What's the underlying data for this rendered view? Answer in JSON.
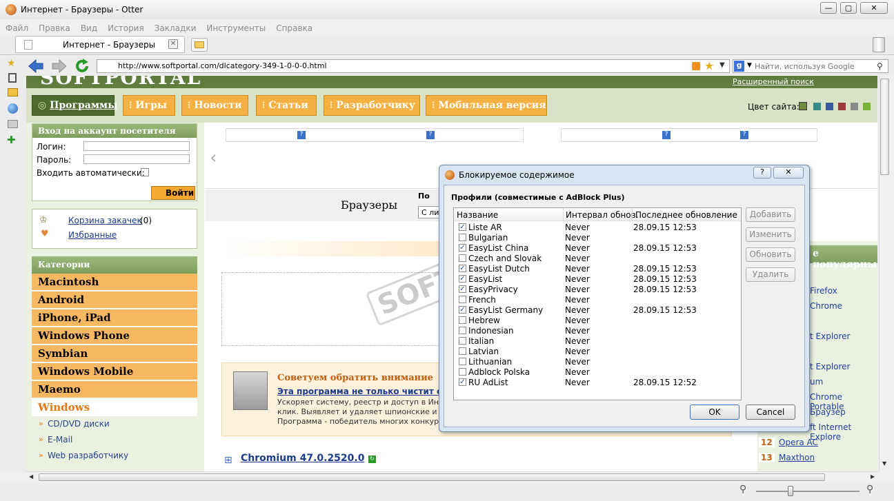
{
  "window": {
    "title": "Интернет - Браузеры - Otter"
  },
  "menu": [
    "Файл",
    "Правка",
    "Вид",
    "История",
    "Закладки",
    "Инструменты",
    "Справка"
  ],
  "tab": {
    "title": "Интернет - Браузеры"
  },
  "address": {
    "url": "http://www.softportal.com/dlcategory-349-1-0-0-0.html"
  },
  "search": {
    "placeholder": "Найти, используя Google"
  },
  "site": {
    "ext_search": "Расширенный поиск",
    "color_label": "Цвет сайта:",
    "colors": [
      "#6b8a3a",
      "#3a8a8a",
      "#3a5aa0",
      "#9a3a3a",
      "#8a8a8a",
      "#7ab23a"
    ],
    "nav": [
      "Программы",
      "Игры",
      "Новости",
      "Статьи",
      "Разработчику",
      "Мобильная версия"
    ],
    "login": {
      "title": "Вход на аккаунт посетителя",
      "login_label": "Логин:",
      "password_label": "Пароль:",
      "auto_label": "Входить автоматически:",
      "submit": "Войти"
    },
    "cart": {
      "label": "Корзина закачек",
      "count": "(0)",
      "favorites": "Избранные"
    },
    "categories_title": "Категории",
    "categories": [
      "Macintosh",
      "Android",
      "iPhone, iPad",
      "Windows Phone",
      "Symbian",
      "Windows Mobile",
      "Maemo",
      "Windows"
    ],
    "subcategories": [
      "CD/DVD диски",
      "E-Mail",
      "Web разработчику"
    ],
    "heading": "Браузеры",
    "sort_label": "По",
    "sort_value": "С ли",
    "promo": {
      "title": "Советуем обратить внимание",
      "link": "Эта программа не только чистит сис",
      "text1": "Ускоряет систему, реестр и доступ в Ин",
      "text2": "клик. Выявляет и удаляет шпионские и",
      "text3": "Программа - победитель многих конкур"
    },
    "entry": {
      "title": "Chromium 47.0.2520.0"
    },
    "popular": {
      "title": "е популярны",
      "items": [
        "Firefox",
        "Chrome",
        "t Explorer",
        "t Explorer",
        "um",
        "Chrome Portable",
        "Браузер",
        "ft Internet Explore",
        "Opera AC",
        "Maxthon"
      ],
      "nums": [
        "12",
        "13"
      ]
    },
    "watermark": "SOFTPORTAL"
  },
  "dialog": {
    "title": "Блокируемое содержимое",
    "group": "Профили (совместимые с AdBlock Plus)",
    "columns": [
      "Название",
      "Интервал обнов.",
      "Последнее обновление"
    ],
    "rows": [
      {
        "name": "Liste AR",
        "interval": "Never",
        "updated": "28.09.15 12:53",
        "checked": "✓"
      },
      {
        "name": "Bulgarian",
        "interval": "Never",
        "updated": "",
        "checked": ""
      },
      {
        "name": "EasyList China",
        "interval": "Never",
        "updated": "28.09.15 12:53",
        "checked": "✓"
      },
      {
        "name": "Czech and Slovak",
        "interval": "Never",
        "updated": "",
        "checked": ""
      },
      {
        "name": "EasyList Dutch",
        "interval": "Never",
        "updated": "28.09.15 12:53",
        "checked": "✓"
      },
      {
        "name": "EasyList",
        "interval": "Never",
        "updated": "28.09.15 12:53",
        "checked": "✓"
      },
      {
        "name": "EasyPrivacy",
        "interval": "Never",
        "updated": "28.09.15 12:53",
        "checked": "✓"
      },
      {
        "name": "French",
        "interval": "Never",
        "updated": "",
        "checked": ""
      },
      {
        "name": "EasyList Germany",
        "interval": "Never",
        "updated": "28.09.15 12:53",
        "checked": "✓"
      },
      {
        "name": "Hebrew",
        "interval": "Never",
        "updated": "",
        "checked": ""
      },
      {
        "name": "Indonesian",
        "interval": "Never",
        "updated": "",
        "checked": ""
      },
      {
        "name": "Italian",
        "interval": "Never",
        "updated": "",
        "checked": ""
      },
      {
        "name": "Latvian",
        "interval": "Never",
        "updated": "",
        "checked": ""
      },
      {
        "name": "Lithuanian",
        "interval": "Never",
        "updated": "",
        "checked": ""
      },
      {
        "name": "Adblock Polska",
        "interval": "Never",
        "updated": "",
        "checked": ""
      },
      {
        "name": "RU AdList",
        "interval": "Never",
        "updated": "28.09.15 12:52",
        "checked": "✓"
      }
    ],
    "buttons": {
      "add": "Добавить",
      "edit": "Изменить",
      "update": "Обновить",
      "delete": "Удалить",
      "ok": "OK",
      "cancel": "Cancel"
    }
  }
}
